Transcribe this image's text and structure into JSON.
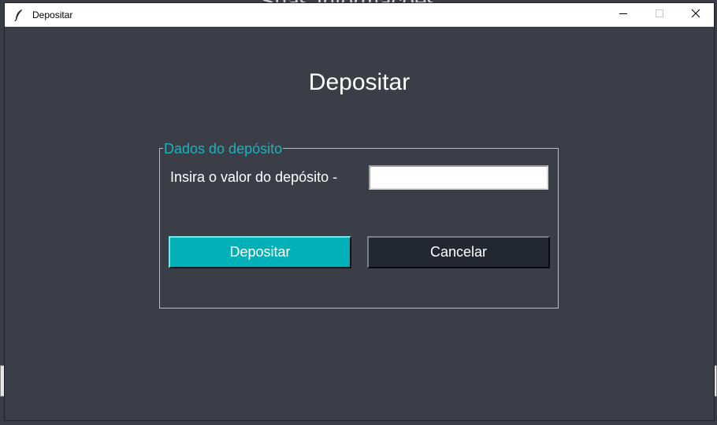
{
  "background": {
    "title_fragment": "Suas Informações"
  },
  "window": {
    "title": "Depositar",
    "icon": "feather-icon",
    "controls": {
      "minimize_icon": "minimize-icon",
      "maximize_icon": "maximize-icon",
      "close_icon": "close-icon"
    }
  },
  "main": {
    "heading": "Depositar",
    "group": {
      "legend": "Dados do depósito",
      "amount_label": "Insira o valor do depósito -",
      "amount_value": "",
      "deposit_button": "Depositar",
      "cancel_button": "Cancelar"
    }
  },
  "colors": {
    "background": "#3b3e46",
    "accent": "#02b0b7",
    "legend": "#19b3bf",
    "cancel_bg": "#232830"
  }
}
